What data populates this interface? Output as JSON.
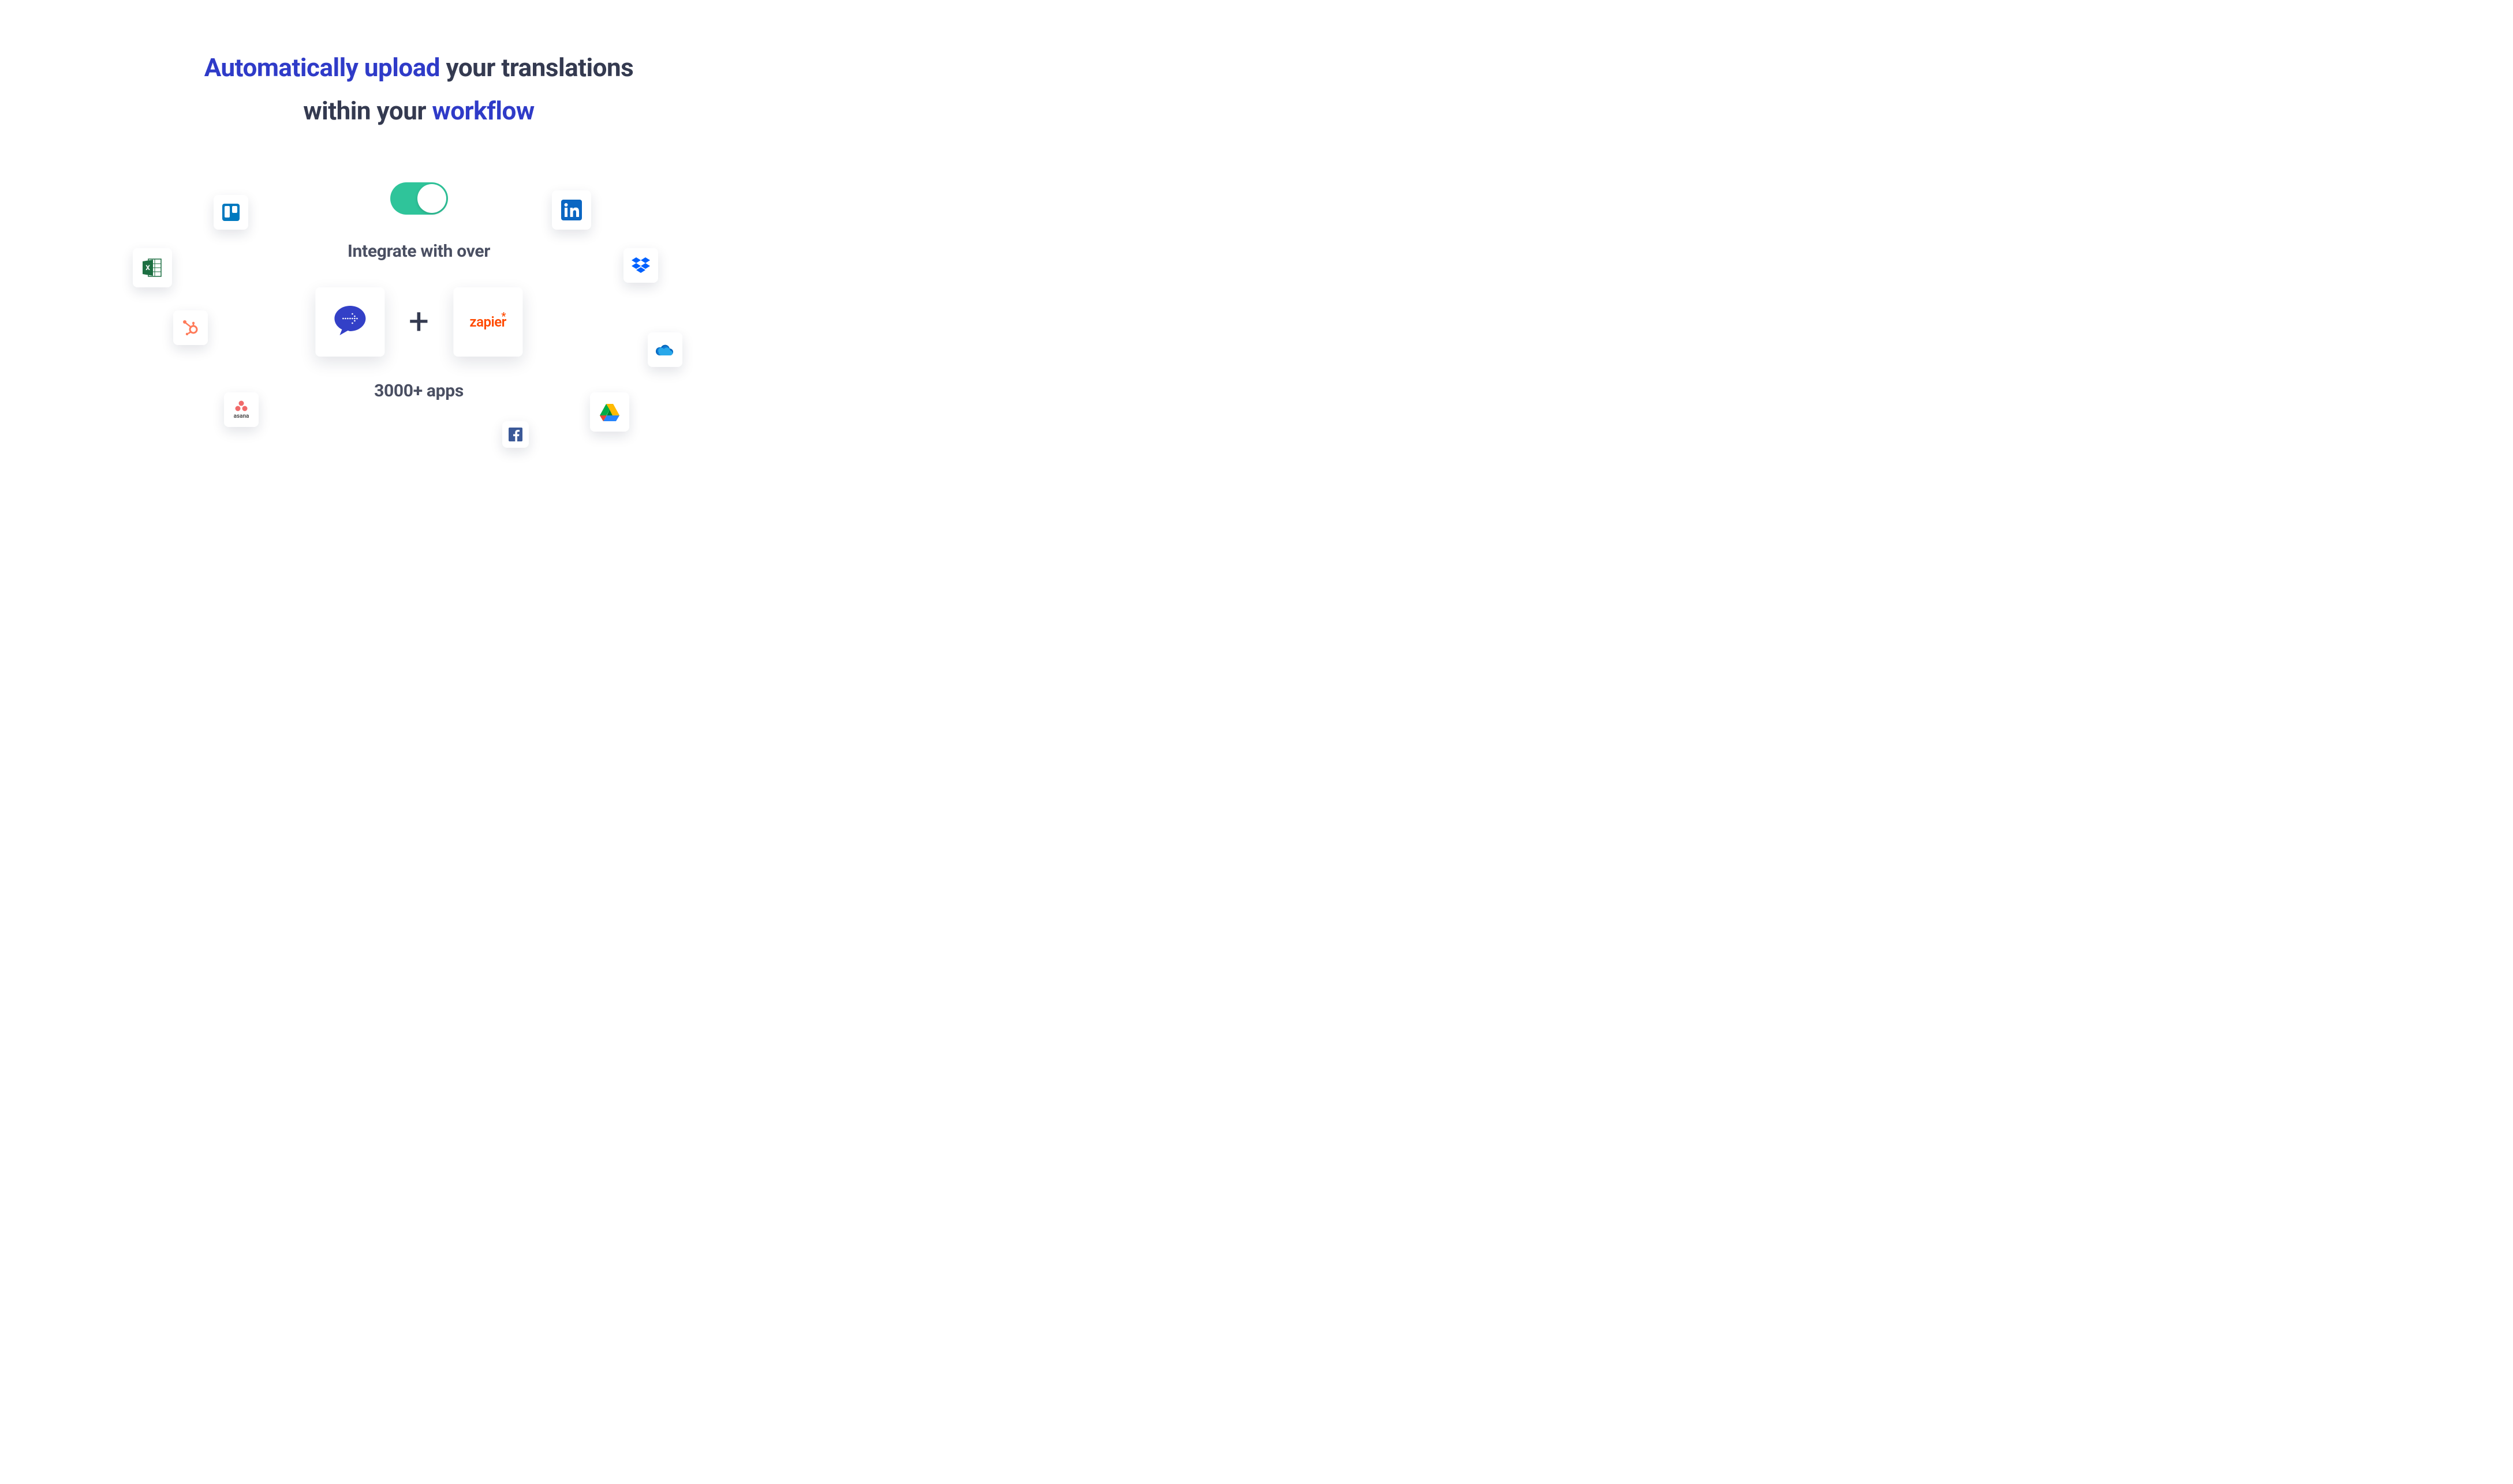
{
  "headline": {
    "part1_accent": "Automatically upload",
    "part2": " your translations",
    "part3": "within your ",
    "part4_accent": "workflow"
  },
  "integrate_label_top": "Integrate with over",
  "integrate_label_bottom": "3000+ apps",
  "zapier_label": "zapier",
  "plus_symbol": "+",
  "asana_label": "asana",
  "colors": {
    "accent_blue": "#2f3bc8",
    "text_dark": "#343a50",
    "toggle_green": "#2fc49a",
    "zapier_orange": "#ff4a00"
  },
  "apps": {
    "trello": "trello-icon",
    "excel": "excel-icon",
    "hubspot": "hubspot-icon",
    "asana": "asana-icon",
    "facebook": "facebook-icon",
    "linkedin": "linkedin-icon",
    "dropbox": "dropbox-icon",
    "onedrive": "onedrive-icon",
    "gdrive": "google-drive-icon",
    "translate": "translate-bubble-icon",
    "zapier": "zapier-icon"
  }
}
